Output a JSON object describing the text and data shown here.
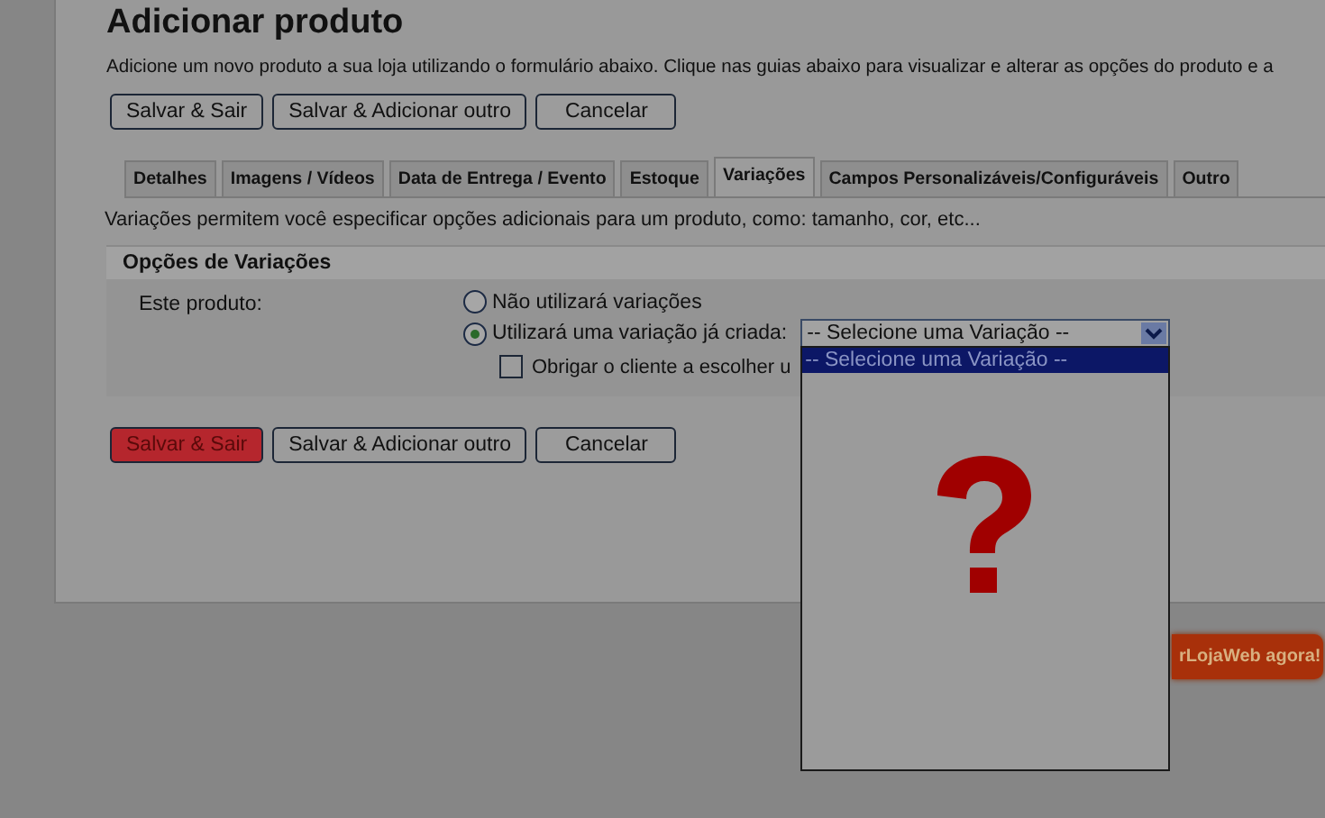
{
  "page": {
    "title": "Adicionar produto",
    "description": "Adicione um novo produto a sua loja utilizando o formulário abaixo. Clique nas guias abaixo para visualizar e alterar as opções do produto e a"
  },
  "top_buttons": [
    {
      "label": "Salvar & Sair",
      "kind": "default"
    },
    {
      "label": "Salvar & Adicionar outro",
      "kind": "default"
    },
    {
      "label": "Cancelar",
      "kind": "default"
    }
  ],
  "tabs": [
    {
      "label": "Detalhes",
      "selected": false
    },
    {
      "label": "Imagens / Vídeos",
      "selected": false
    },
    {
      "label": "Data de Entrega / Evento",
      "selected": false
    },
    {
      "label": "Estoque",
      "selected": false
    },
    {
      "label": "Variações",
      "selected": true
    },
    {
      "label": "Campos Personalizáveis/Configuráveis",
      "selected": false
    },
    {
      "label": "Outro",
      "selected": false
    }
  ],
  "intro": "Variações permitem você especificar opções adicionais para um produto, como: tamanho, cor, etc...",
  "section": {
    "title": "Opções de Variações",
    "field_label": "Este produto:",
    "options": [
      {
        "label": "Não utilizará variações",
        "selected": false
      },
      {
        "label": "Utilizará uma variação já criada:",
        "selected": true
      }
    ],
    "select": {
      "value": "-- Selecione uma Variação --",
      "open": true,
      "options": [
        {
          "label": "-- Selecione uma Variação --",
          "selected": true
        }
      ]
    },
    "checkbox": {
      "label": "Obrigar o cliente a escolher u",
      "checked": false
    }
  },
  "bottom_buttons": [
    {
      "label": "Salvar & Sair",
      "kind": "primary"
    },
    {
      "label": "Salvar & Adicionar outro",
      "kind": "default"
    },
    {
      "label": "Cancelar",
      "kind": "default"
    }
  ],
  "promo_button": "rLojaWeb agora!"
}
